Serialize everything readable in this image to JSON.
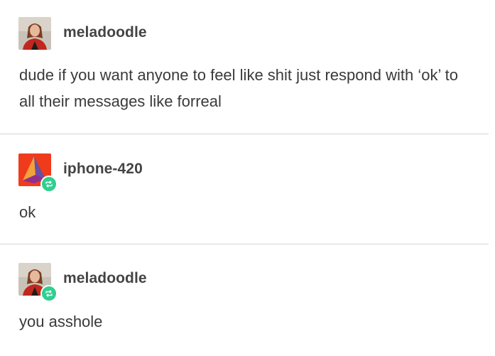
{
  "posts": [
    {
      "username": "meladoodle",
      "avatar_icon": "person-photo-avatar",
      "reblogged": false,
      "body": "dude if you want anyone to feel like shit just respond with ‘ok’ to all their messages like forreal"
    },
    {
      "username": "iphone-420",
      "avatar_icon": "pyramid-avatar",
      "reblogged": true,
      "body": "ok"
    },
    {
      "username": "meladoodle",
      "avatar_icon": "person-photo-avatar",
      "reblogged": true,
      "body": "you asshole"
    }
  ],
  "colors": {
    "reblog_badge": "#2fcf8f",
    "divider": "#d6d6d6",
    "username": "#444444",
    "body_text": "#3a3a3a",
    "pyramid_bg": "#ef3b1c",
    "pyramid_orange": "#f2a23a",
    "pyramid_purple": "#6a4fa3"
  }
}
